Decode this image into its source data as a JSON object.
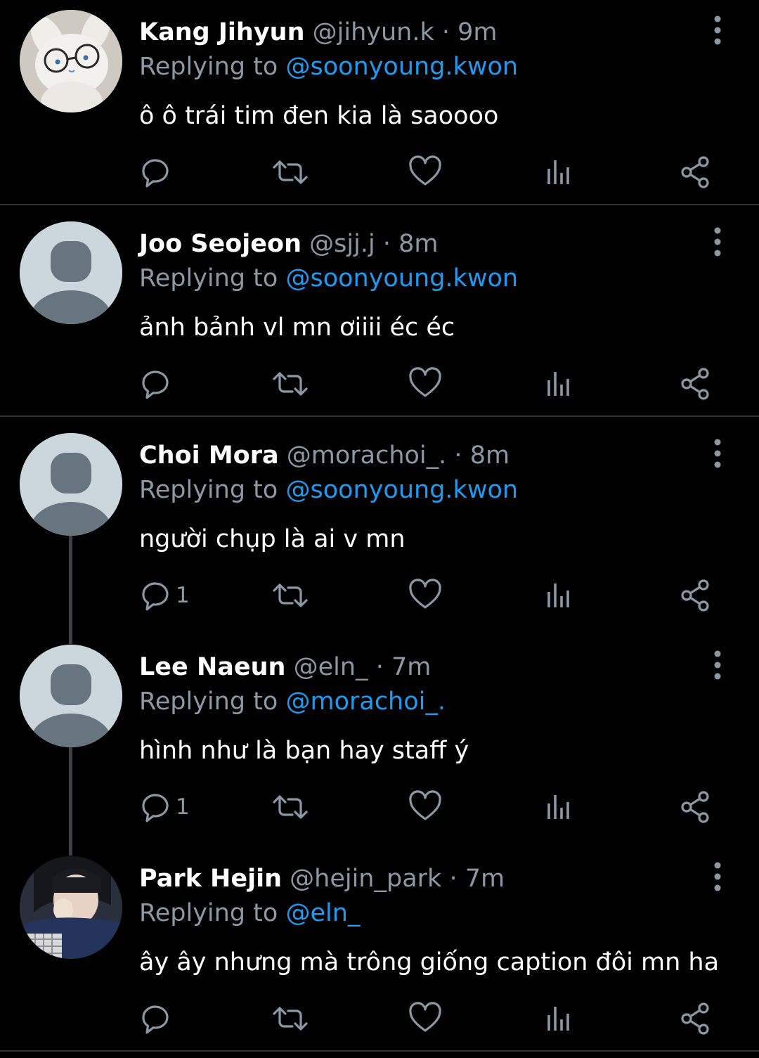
{
  "colors": {
    "background": "#000000",
    "divider": "#2f3336",
    "name": "#ffffff",
    "meta": "#8b98a5",
    "mention": "#1d9bf0",
    "icon": "#8b98a5"
  },
  "icons": {
    "reply": "reply-icon",
    "retweet": "retweet-icon",
    "like": "heart-icon",
    "views": "views-icon",
    "share": "share-icon",
    "more": "more-vertical-icon"
  },
  "replies": [
    {
      "name": "Kang Jihyun",
      "handle": "@jihyun.k",
      "time": "9m",
      "replying_prefix": "Replying to",
      "replying_to": "@soonyoung.kwon",
      "text": "ô ô trái tim đen kia là saoooo",
      "reply_count": "",
      "avatar": "plush-bunny-with-glasses-photo"
    },
    {
      "name": "Joo Seojeon",
      "handle": "@sjj.j",
      "time": "8m",
      "replying_prefix": "Replying to",
      "replying_to": "@soonyoung.kwon",
      "text": "ảnh bảnh vl mn ơiiii éc éc",
      "reply_count": "",
      "avatar": "default-avatar"
    },
    {
      "name": "Choi Mora",
      "handle": "@morachoi_.",
      "time": "8m",
      "replying_prefix": "Replying to",
      "replying_to": "@soonyoung.kwon",
      "text": "người chụp là ai v mn",
      "reply_count": "1",
      "avatar": "default-avatar"
    },
    {
      "name": "Lee Naeun",
      "handle": "@eln_",
      "time": "7m",
      "replying_prefix": "Replying to",
      "replying_to": "@morachoi_.",
      "text": "hình như là bạn hay staff ý",
      "reply_count": "1",
      "avatar": "default-avatar"
    },
    {
      "name": "Park Hejin",
      "handle": "@hejin_park",
      "time": "7m",
      "replying_prefix": "Replying to",
      "replying_to": "@eln_",
      "text": "ây ây nhưng mà trông giống caption đôi mn ha",
      "reply_count": "",
      "avatar": "girl-selfie-photo"
    }
  ]
}
